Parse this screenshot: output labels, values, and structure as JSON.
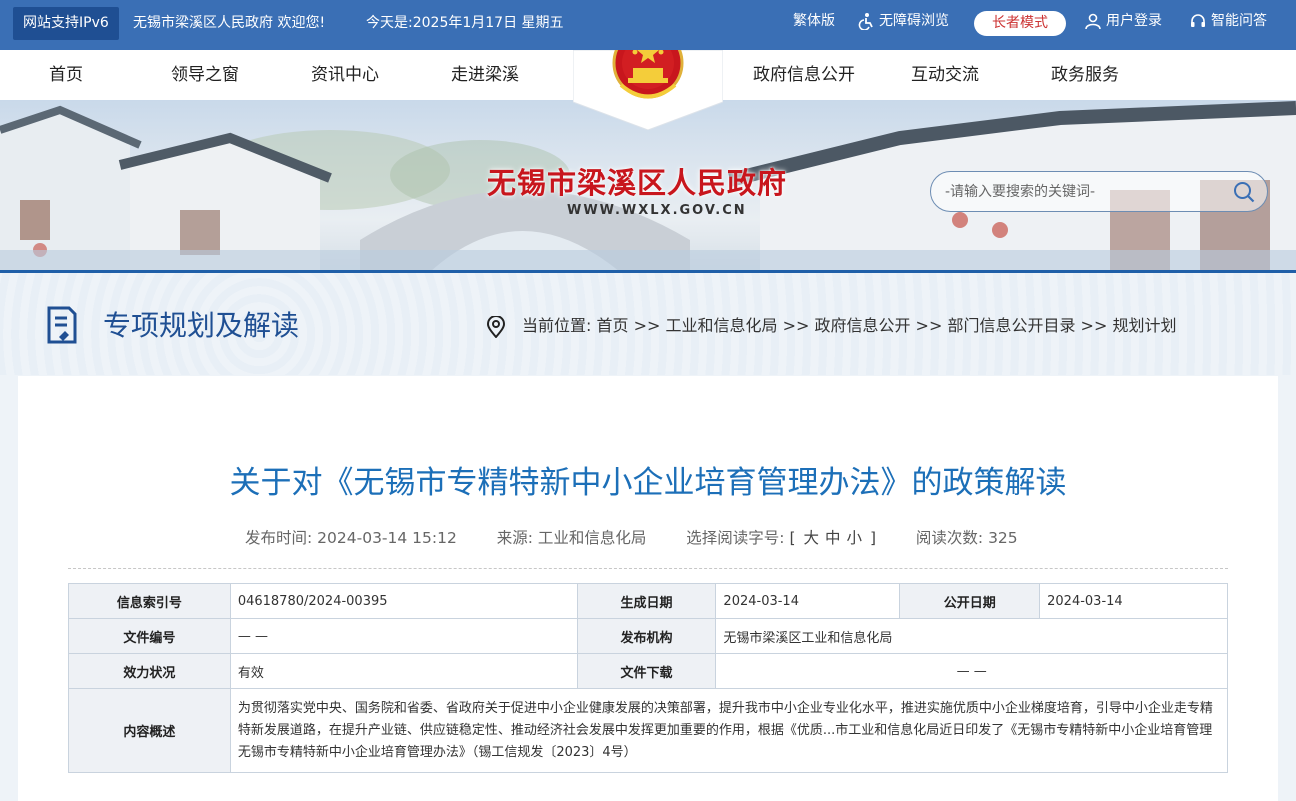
{
  "topbar": {
    "ipv6": "网站支持IPv6",
    "welcome": "无锡市梁溪区人民政府  欢迎您!",
    "today": "今天是:2025年1月17日 星期五",
    "traditional": "繁体版",
    "accessible": "无障碍浏览",
    "elder_mode": "长者模式",
    "login": "用户登录",
    "smart_qa": "智能问答"
  },
  "nav": {
    "items_left": [
      "首页",
      "领导之窗",
      "资讯中心",
      "走进梁溪"
    ],
    "items_right": [
      "政府信息公开",
      "互动交流",
      "政务服务"
    ]
  },
  "banner": {
    "site_title": "无锡市梁溪区人民政府",
    "site_url": "WWW.WXLX.GOV.CN",
    "search_placeholder": "-请输入要搜索的关键词-"
  },
  "section": {
    "title": "专项规划及解读",
    "location_label": "当前位置:",
    "breadcrumb": "首页 >> 工业和信息化局 >> 政府信息公开 >> 部门信息公开目录 >> 规划计划"
  },
  "article": {
    "title": "关于对《无锡市专精特新中小企业培育管理办法》的政策解读",
    "publish_label": "发布时间:",
    "publish_time": "2024-03-14 15:12",
    "source_label": "来源:",
    "source": "工业和信息化局",
    "fontsize_label": "选择阅读字号:",
    "fontsize_open": "[",
    "fontsize_large": "大",
    "fontsize_medium": "中",
    "fontsize_small": "小",
    "fontsize_close": "]",
    "reads_label": "阅读次数:",
    "reads": "325"
  },
  "info_table": {
    "index_label": "信息索引号",
    "index_value": "04618780/2024-00395",
    "created_label": "生成日期",
    "created_value": "2024-03-14",
    "public_label": "公开日期",
    "public_value": "2024-03-14",
    "docno_label": "文件编号",
    "docno_value": "— —",
    "issuer_label": "发布机构",
    "issuer_value": "无锡市梁溪区工业和信息化局",
    "status_label": "效力状况",
    "status_value": "有效",
    "download_label": "文件下载",
    "download_value": "— —",
    "summary_label": "内容概述",
    "summary_value": "为贯彻落实党中央、国务院和省委、省政府关于促进中小企业健康发展的决策部署，提升我市中小企业专业化水平，推进实施优质中小企业梯度培育，引导中小企业走专精特新发展道路，在提升产业链、供应链稳定性、推动经济社会发展中发挥更加重要的作用，根据《优质...市工业和信息化局近日印发了《无锡市专精特新中小企业培育管理无锡市专精特新中小企业培育管理办法》（锡工信规发〔2023〕4号）"
  },
  "colors": {
    "topbar": "#3a6fb5",
    "title_red": "#c8161d",
    "article_blue": "#1c6fb8",
    "section_blue": "#1f4f93"
  }
}
